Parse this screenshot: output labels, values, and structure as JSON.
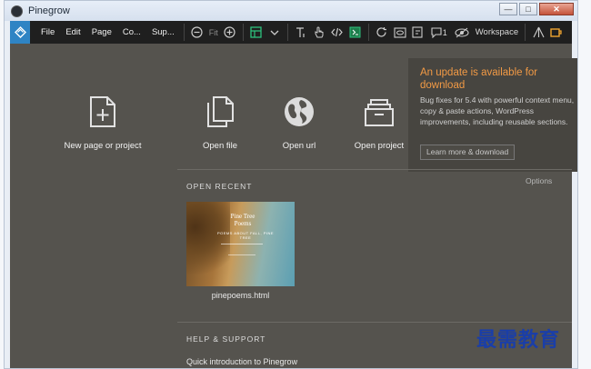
{
  "window": {
    "title": "Pinegrow",
    "controls": [
      "—",
      "□",
      "✕"
    ]
  },
  "toolbar": {
    "menu": [
      "File",
      "Edit",
      "Page",
      "Co...",
      "Sup..."
    ],
    "zoom_label": "Fit",
    "badge_count": "1",
    "workspace_label": "Workspace"
  },
  "actions": [
    {
      "label": "New page or project",
      "icon": "new-page-icon"
    },
    {
      "label": "Open file",
      "icon": "open-file-icon"
    },
    {
      "label": "Open url",
      "icon": "globe-icon"
    },
    {
      "label": "Open project",
      "icon": "open-project-icon"
    }
  ],
  "update": {
    "title": "An update is available for download",
    "body": "Bug fixes for 5.4 with powerful context menu, copy & paste actions, WordPress improvements, including reusable sections.",
    "button": "Learn more & download"
  },
  "options_label": "Options",
  "recent": {
    "title": "OPEN RECENT",
    "file": "pinepoems.html",
    "thumb_title": "Pine Tree Poems",
    "thumb_subtitle": "POEMS ABOUT FALL, PINE TREE"
  },
  "help": {
    "title": "HELP & SUPPORT",
    "link": "Quick introduction to Pinegrow"
  },
  "watermark": "最需教育",
  "colors": {
    "accent": "#f29a45",
    "toolbar": "#1f1f1f",
    "content": "#55534e",
    "logo": "#2f84c4"
  }
}
